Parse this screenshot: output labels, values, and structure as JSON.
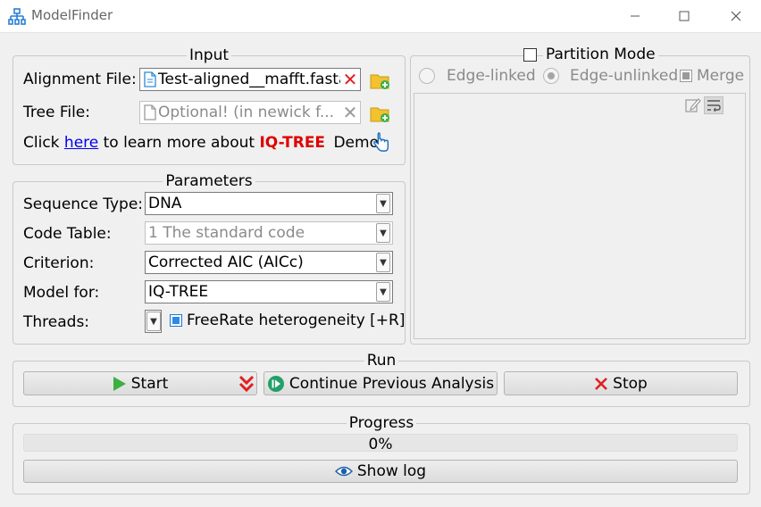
{
  "window": {
    "title": "ModelFinder",
    "minimize_symbol": "—",
    "maximize_symbol": "☐",
    "close_symbol": "✕"
  },
  "input": {
    "legend": "Input",
    "alignment_label": "Alignment File:",
    "alignment_value": "Test-aligned__mafft.fasta",
    "tree_label": "Tree File:",
    "tree_placeholder": "Optional! (in newick f...",
    "learn_prefix": "Click ",
    "learn_link": "here",
    "learn_middle": " to learn more about ",
    "learn_brand": "IQ-TREE",
    "demo_label": "Demo:"
  },
  "parameters": {
    "legend": "Parameters",
    "sequence_type_label": "Sequence Type:",
    "sequence_type_value": "DNA",
    "code_table_label": "Code Table:",
    "code_table_value": "1 The standard code",
    "criterion_label": "Criterion:",
    "criterion_value": "Corrected AIC (AICc)",
    "model_for_label": "Model for:",
    "model_for_value": "IQ-TREE",
    "threads_label": "Threads:",
    "freerate_label": "FreeRate heterogeneity [+R]",
    "freerate_checked": true
  },
  "partition": {
    "legend": "Partition Mode",
    "enabled": false,
    "edge_linked": "Edge-linked",
    "edge_unlinked": "Edge-unlinked",
    "merge": "Merge",
    "selected": "Edge-unlinked"
  },
  "run": {
    "legend": "Run",
    "start": "Start",
    "continue": "Continue Previous Analysis",
    "stop": "Stop"
  },
  "progress": {
    "legend": "Progress",
    "value_percent": 0,
    "text": "0%",
    "show_log": "Show log"
  },
  "colors": {
    "accent_blue": "#2d8be8",
    "start_green": "#3cb043",
    "stop_red": "#e02020",
    "brand_red": "#e00000",
    "folder_yellow": "#f2c230"
  }
}
